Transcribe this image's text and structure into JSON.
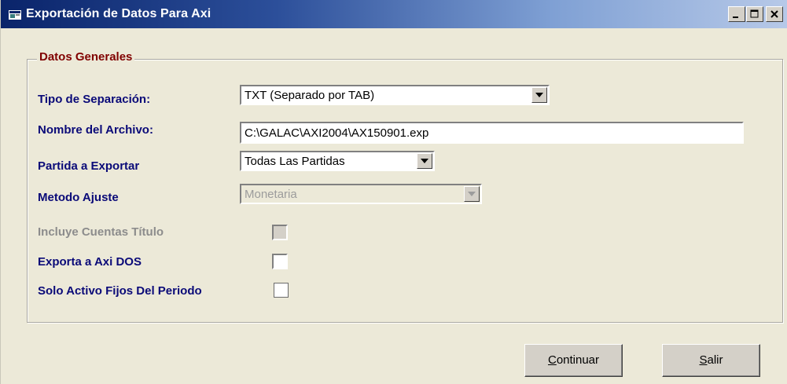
{
  "window": {
    "title": "Exportación de Datos Para Axi",
    "controls": {
      "minimize": "minimize-icon",
      "maximize": "maximize-icon",
      "close": "close-icon"
    }
  },
  "group": {
    "title": "Datos Generales"
  },
  "fields": {
    "tipo_separacion": {
      "label": "Tipo de Separación:",
      "value": "TXT (Separado por TAB)"
    },
    "nombre_archivo": {
      "label": "Nombre del Archivo:",
      "value": "C:\\GALAC\\AXI2004\\AX150901.exp"
    },
    "partida_exportar": {
      "label": "Partida a Exportar",
      "value": "Todas Las Partidas"
    },
    "metodo_ajuste": {
      "label": "Metodo Ajuste",
      "value": "Monetaria",
      "disabled": true
    },
    "incluye_cuentas": {
      "label": "Incluye Cuentas Título",
      "checked": false,
      "disabled": true
    },
    "exporta_axi_dos": {
      "label": "Exporta a Axi DOS",
      "checked": false
    },
    "solo_activo": {
      "label": "Solo Activo Fijos Del Periodo",
      "checked": false
    }
  },
  "buttons": {
    "continuar": {
      "accel": "C",
      "rest": "ontinuar"
    },
    "salir": {
      "accel": "S",
      "rest": "alir"
    }
  },
  "colors": {
    "title_gradient_start": "#0a246a",
    "title_gradient_end": "#b7c9e8",
    "label_text": "#0a0a78",
    "group_title": "#800000",
    "window_bg": "#ece9d8"
  }
}
